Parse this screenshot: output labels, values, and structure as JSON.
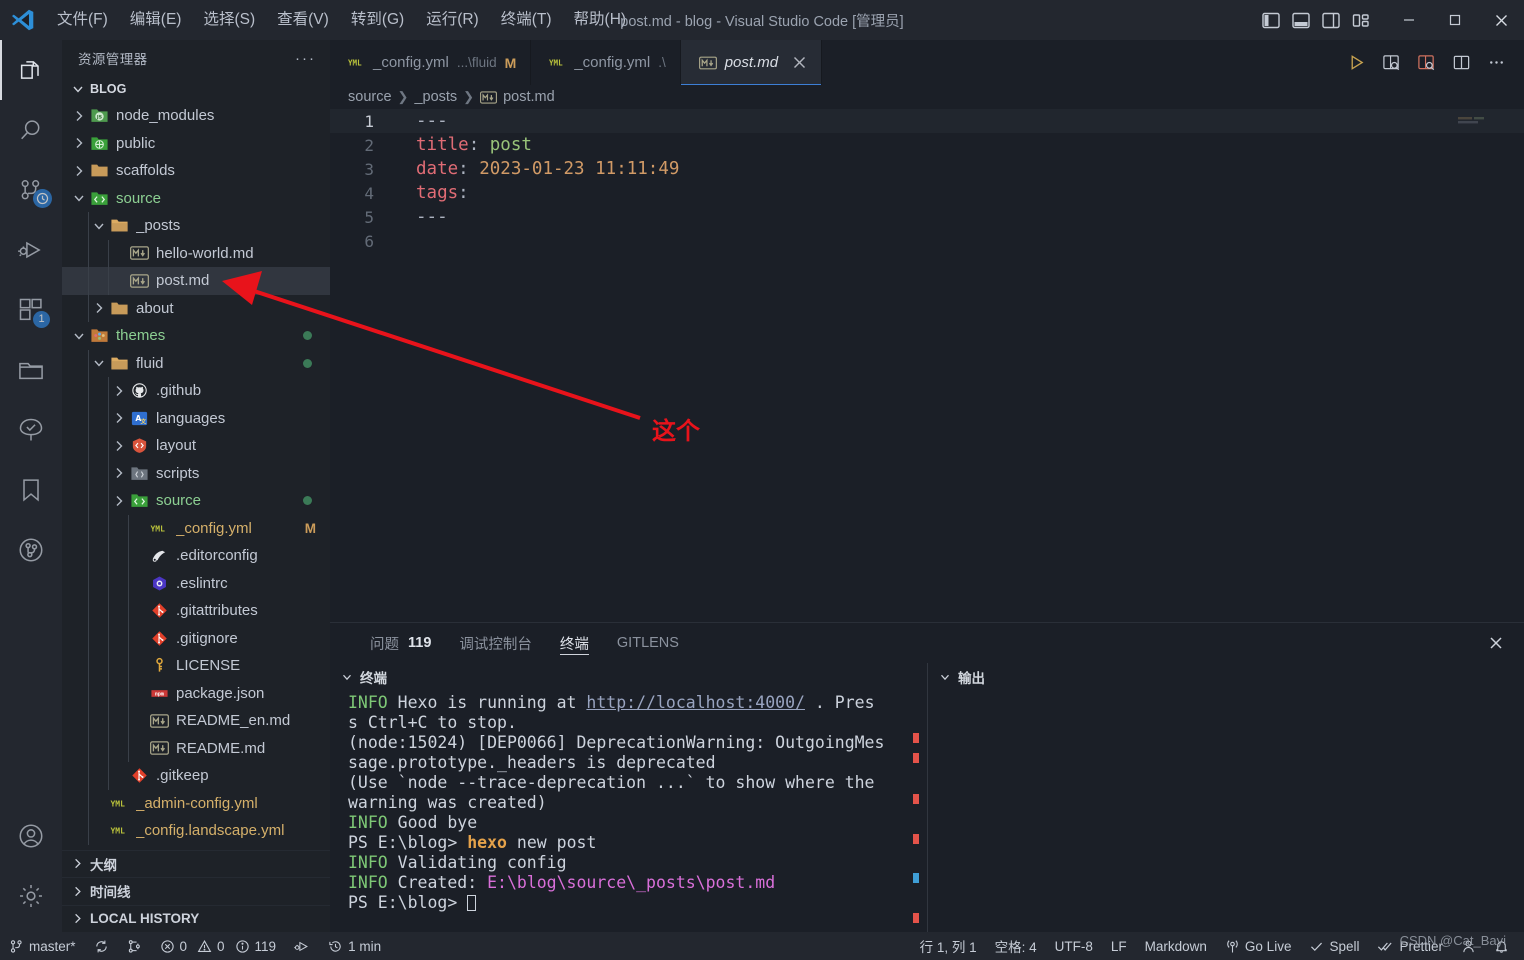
{
  "window": {
    "title": "post.md - blog - Visual Studio Code [管理员]",
    "logo_icon": "vscode-logo-icon",
    "controls": {
      "toggle_primary_sidebar": "toggle-primary-sidebar-icon",
      "toggle_panel": "toggle-panel-icon",
      "toggle_secondary_sidebar": "toggle-secondary-sidebar-icon",
      "customize_layout": "customize-layout-icon",
      "minimize": "minimize-icon",
      "maximize": "maximize-icon",
      "close": "close-icon"
    }
  },
  "menubar": [
    {
      "label": "文件(F)"
    },
    {
      "label": "编辑(E)"
    },
    {
      "label": "选择(S)"
    },
    {
      "label": "查看(V)"
    },
    {
      "label": "转到(G)"
    },
    {
      "label": "运行(R)"
    },
    {
      "label": "终端(T)"
    },
    {
      "label": "帮助(H)"
    }
  ],
  "activitybar": [
    {
      "name": "explorer",
      "icon": "files-icon",
      "active": true,
      "badge": ""
    },
    {
      "name": "search",
      "icon": "search-icon",
      "active": false,
      "badge": ""
    },
    {
      "name": "source-control",
      "icon": "source-control-icon",
      "active": false,
      "badge": ""
    },
    {
      "name": "run-and-debug",
      "icon": "run-debug-icon",
      "active": false,
      "badge": ""
    },
    {
      "name": "extensions",
      "icon": "extensions-icon",
      "active": false,
      "badge": "1"
    },
    {
      "name": "remote-explorer",
      "icon": "folder-icon",
      "active": false,
      "badge": ""
    },
    {
      "name": "test-explorer",
      "icon": "tree-icon",
      "active": false,
      "badge": ""
    },
    {
      "name": "bookmarks",
      "icon": "bookmark-icon",
      "active": false,
      "badge": ""
    },
    {
      "name": "gitlens",
      "icon": "gitlens-icon",
      "active": false,
      "badge": ""
    },
    {
      "name": "accounts",
      "icon": "account-icon",
      "active": false,
      "badge": ""
    },
    {
      "name": "settings",
      "icon": "gear-icon",
      "active": false,
      "badge": ""
    }
  ],
  "sidebar": {
    "header_title": "资源管理器",
    "more_actions": "···",
    "root_label": "BLOG",
    "tree": [
      {
        "label": "node_modules",
        "indent": 1,
        "kind": "folder",
        "icon": "nodejs-folder-icon",
        "expanded": false,
        "badge": "",
        "dot": false,
        "selected": false
      },
      {
        "label": "public",
        "indent": 1,
        "kind": "folder",
        "icon": "public-folder-icon",
        "expanded": false,
        "badge": "",
        "dot": false,
        "selected": false
      },
      {
        "label": "scaffolds",
        "indent": 1,
        "kind": "folder",
        "icon": "folder-icon",
        "expanded": false,
        "badge": "",
        "dot": false,
        "selected": false
      },
      {
        "label": "source",
        "indent": 1,
        "kind": "folder",
        "icon": "src-folder-icon",
        "expanded": true,
        "badge": "",
        "dot": false,
        "selected": false
      },
      {
        "label": "_posts",
        "indent": 2,
        "kind": "folder",
        "icon": "folder-open-icon",
        "expanded": true,
        "badge": "",
        "dot": false,
        "selected": false
      },
      {
        "label": "hello-world.md",
        "indent": 3,
        "kind": "file",
        "icon": "markdown-icon",
        "expanded": null,
        "badge": "",
        "dot": false,
        "selected": false
      },
      {
        "label": "post.md",
        "indent": 3,
        "kind": "file",
        "icon": "markdown-icon",
        "expanded": null,
        "badge": "",
        "dot": false,
        "selected": true
      },
      {
        "label": "about",
        "indent": 2,
        "kind": "folder",
        "icon": "folder-icon",
        "expanded": false,
        "badge": "",
        "dot": false,
        "selected": false
      },
      {
        "label": "themes",
        "indent": 1,
        "kind": "folder",
        "icon": "theme-folder-icon",
        "expanded": true,
        "badge": "",
        "dot": true,
        "selected": false
      },
      {
        "label": "fluid",
        "indent": 2,
        "kind": "folder",
        "icon": "folder-open-icon",
        "expanded": true,
        "badge": "",
        "dot": true,
        "selected": false
      },
      {
        "label": ".github",
        "indent": 3,
        "kind": "folder",
        "icon": "github-icon",
        "expanded": false,
        "badge": "",
        "dot": false,
        "selected": false
      },
      {
        "label": "languages",
        "indent": 3,
        "kind": "folder",
        "icon": "i18n-folder-icon",
        "expanded": false,
        "badge": "",
        "dot": false,
        "selected": false
      },
      {
        "label": "layout",
        "indent": 3,
        "kind": "folder",
        "icon": "layout-folder-icon",
        "expanded": false,
        "badge": "",
        "dot": false,
        "selected": false
      },
      {
        "label": "scripts",
        "indent": 3,
        "kind": "folder",
        "icon": "scripts-folder-icon",
        "expanded": false,
        "badge": "",
        "dot": false,
        "selected": false
      },
      {
        "label": "source",
        "indent": 3,
        "kind": "folder",
        "icon": "src-folder-icon",
        "expanded": false,
        "badge": "",
        "dot": true,
        "selected": false
      },
      {
        "label": "_config.yml",
        "indent": 4,
        "kind": "file",
        "icon": "yaml-icon",
        "expanded": null,
        "badge": "M",
        "dot": false,
        "selected": false
      },
      {
        "label": ".editorconfig",
        "indent": 4,
        "kind": "file",
        "icon": "editorconfig-icon",
        "expanded": null,
        "badge": "",
        "dot": false,
        "selected": false
      },
      {
        "label": ".eslintrc",
        "indent": 4,
        "kind": "file",
        "icon": "eslint-icon",
        "expanded": null,
        "badge": "",
        "dot": false,
        "selected": false
      },
      {
        "label": ".gitattributes",
        "indent": 4,
        "kind": "file",
        "icon": "git-icon",
        "expanded": null,
        "badge": "",
        "dot": false,
        "selected": false
      },
      {
        "label": ".gitignore",
        "indent": 4,
        "kind": "file",
        "icon": "git-icon",
        "expanded": null,
        "badge": "",
        "dot": false,
        "selected": false
      },
      {
        "label": "LICENSE",
        "indent": 4,
        "kind": "file",
        "icon": "license-icon",
        "expanded": null,
        "badge": "",
        "dot": false,
        "selected": false
      },
      {
        "label": "package.json",
        "indent": 4,
        "kind": "file",
        "icon": "npm-icon",
        "expanded": null,
        "badge": "",
        "dot": false,
        "selected": false
      },
      {
        "label": "README_en.md",
        "indent": 4,
        "kind": "file",
        "icon": "markdown-icon",
        "expanded": null,
        "badge": "",
        "dot": false,
        "selected": false
      },
      {
        "label": "README.md",
        "indent": 4,
        "kind": "file",
        "icon": "markdown-icon",
        "expanded": null,
        "badge": "",
        "dot": false,
        "selected": false
      },
      {
        "label": ".gitkeep",
        "indent": 3,
        "kind": "file",
        "icon": "git-icon",
        "expanded": null,
        "badge": "",
        "dot": false,
        "selected": false
      },
      {
        "label": "_admin-config.yml",
        "indent": 2,
        "kind": "file",
        "icon": "yaml-icon",
        "expanded": null,
        "badge": "",
        "dot": false,
        "selected": false
      },
      {
        "label": "_config.landscape.yml",
        "indent": 2,
        "kind": "file",
        "icon": "yaml-icon",
        "expanded": null,
        "badge": "",
        "dot": false,
        "selected": false
      }
    ],
    "bottom_sections": [
      {
        "label": "大纲"
      },
      {
        "label": "时间线"
      },
      {
        "label": "LOCAL HISTORY"
      }
    ]
  },
  "tabs": [
    {
      "name": "_config.yml",
      "path": "...\\fluid",
      "modified": "M",
      "icon": "yaml-icon",
      "active": false
    },
    {
      "name": "_config.yml",
      "path": ".\\",
      "modified": "",
      "icon": "yaml-icon",
      "active": false
    },
    {
      "name": "post.md",
      "path": "",
      "modified": "",
      "icon": "markdown-icon",
      "active": true
    }
  ],
  "editor_actions": [
    {
      "name": "run-code-button",
      "icon": "play-icon"
    },
    {
      "name": "open-preview-button",
      "icon": "preview-icon"
    },
    {
      "name": "open-preview-side-button",
      "icon": "preview-side-icon"
    },
    {
      "name": "split-editor-button",
      "icon": "split-editor-icon"
    },
    {
      "name": "more-actions-button",
      "icon": "ellipsis-icon"
    }
  ],
  "breadcrumb": [
    {
      "label": "source",
      "icon": ""
    },
    {
      "label": "_posts",
      "icon": ""
    },
    {
      "label": "post.md",
      "icon": "markdown-icon"
    }
  ],
  "editor": {
    "lines": [
      {
        "n": "1",
        "tokens": [
          {
            "t": "---",
            "c": "pun"
          }
        ]
      },
      {
        "n": "2",
        "tokens": [
          {
            "t": "title",
            "c": "key"
          },
          {
            "t": ": ",
            "c": "pun"
          },
          {
            "t": "post",
            "c": "str"
          }
        ]
      },
      {
        "n": "3",
        "tokens": [
          {
            "t": "date",
            "c": "key"
          },
          {
            "t": ": ",
            "c": "pun"
          },
          {
            "t": "2023-01-23 11:11:49",
            "c": "num"
          }
        ]
      },
      {
        "n": "4",
        "tokens": [
          {
            "t": "tags",
            "c": "key"
          },
          {
            "t": ":",
            "c": "pun"
          }
        ]
      },
      {
        "n": "5",
        "tokens": [
          {
            "t": "---",
            "c": "pun"
          }
        ]
      },
      {
        "n": "6",
        "tokens": []
      }
    ],
    "current_line": 1
  },
  "annotation": {
    "text": "这个",
    "color": "#e8131b"
  },
  "panel": {
    "tabs": [
      {
        "label": "问题",
        "count": "119",
        "active": false
      },
      {
        "label": "调试控制台",
        "count": "",
        "active": false
      },
      {
        "label": "终端",
        "count": "",
        "active": true
      },
      {
        "label": "GITLENS",
        "count": "",
        "active": false
      }
    ],
    "close_icon": "close-icon",
    "terminal_pane_title": "终端",
    "output_pane_title": "输出",
    "terminal_lines": [
      [
        {
          "t": "INFO ",
          "c": "info"
        },
        {
          "t": " Hexo is running at ",
          "c": ""
        },
        {
          "t": "http://localhost:4000/",
          "c": "link"
        },
        {
          "t": " . Pres",
          "c": ""
        }
      ],
      [
        {
          "t": "s Ctrl+C to stop.",
          "c": ""
        }
      ],
      [
        {
          "t": "(node:15024) [DEP0066] DeprecationWarning: OutgoingMes",
          "c": ""
        }
      ],
      [
        {
          "t": "sage.prototype._headers is deprecated",
          "c": ""
        }
      ],
      [
        {
          "t": "(Use `node --trace-deprecation ...` to show where the",
          "c": ""
        }
      ],
      [
        {
          "t": "warning was created)",
          "c": ""
        }
      ],
      [
        {
          "t": "INFO ",
          "c": "info"
        },
        {
          "t": " Good bye",
          "c": ""
        }
      ],
      [
        {
          "t": "PS E:\\blog> ",
          "c": ""
        },
        {
          "t": "hexo",
          "c": "cmd"
        },
        {
          "t": " new post",
          "c": ""
        }
      ],
      [
        {
          "t": "INFO ",
          "c": "info"
        },
        {
          "t": " Validating config",
          "c": ""
        }
      ],
      [
        {
          "t": "INFO ",
          "c": "info"
        },
        {
          "t": " Created: ",
          "c": ""
        },
        {
          "t": "E:\\blog\\source\\_posts\\post.md",
          "c": "path"
        }
      ],
      [
        {
          "t": "PS E:\\blog> ",
          "c": ""
        },
        {
          "t": "",
          "c": "cursor"
        }
      ]
    ]
  },
  "statusbar": {
    "left": [
      {
        "name": "branch",
        "icon": "source-control-icon",
        "label": "master*"
      },
      {
        "name": "sync",
        "icon": "sync-icon",
        "label": ""
      },
      {
        "name": "git-graph",
        "icon": "git-graph-icon",
        "label": ""
      },
      {
        "name": "errors",
        "icon": "error-icon",
        "label": "0"
      },
      {
        "name": "warnings",
        "icon": "warning-icon",
        "label": "0"
      },
      {
        "name": "infos",
        "icon": "info-icon",
        "label": "119"
      },
      {
        "name": "run-debug",
        "icon": "run-debug-icon",
        "label": ""
      },
      {
        "name": "timer",
        "icon": "history-icon",
        "label": "1 min"
      }
    ],
    "right": [
      {
        "name": "cursor-position",
        "icon": "",
        "label": "行 1, 列 1"
      },
      {
        "name": "indentation",
        "icon": "",
        "label": "空格: 4"
      },
      {
        "name": "encoding",
        "icon": "",
        "label": "UTF-8"
      },
      {
        "name": "eol",
        "icon": "",
        "label": "LF"
      },
      {
        "name": "language-mode",
        "icon": "",
        "label": "Markdown"
      },
      {
        "name": "go-live",
        "icon": "broadcast-icon",
        "label": "Go Live"
      },
      {
        "name": "spell-checker",
        "icon": "check-icon",
        "label": "Spell"
      },
      {
        "name": "prettier",
        "icon": "check-all-icon",
        "label": "Prettier"
      },
      {
        "name": "feedback",
        "icon": "person-icon",
        "label": ""
      },
      {
        "name": "notifications",
        "icon": "bell-icon",
        "label": ""
      }
    ],
    "watermark": "CSDN @Cat_Bayi"
  },
  "colors": {
    "accent": "#3d7fd6",
    "badge": "#2f7fd1",
    "annotation_red": "#e8131b",
    "titlebar_bg": "#23272f",
    "editor_bg": "#1b1f27",
    "sidebar_bg": "#1e2228",
    "modified_m": "#cb9c5a"
  }
}
